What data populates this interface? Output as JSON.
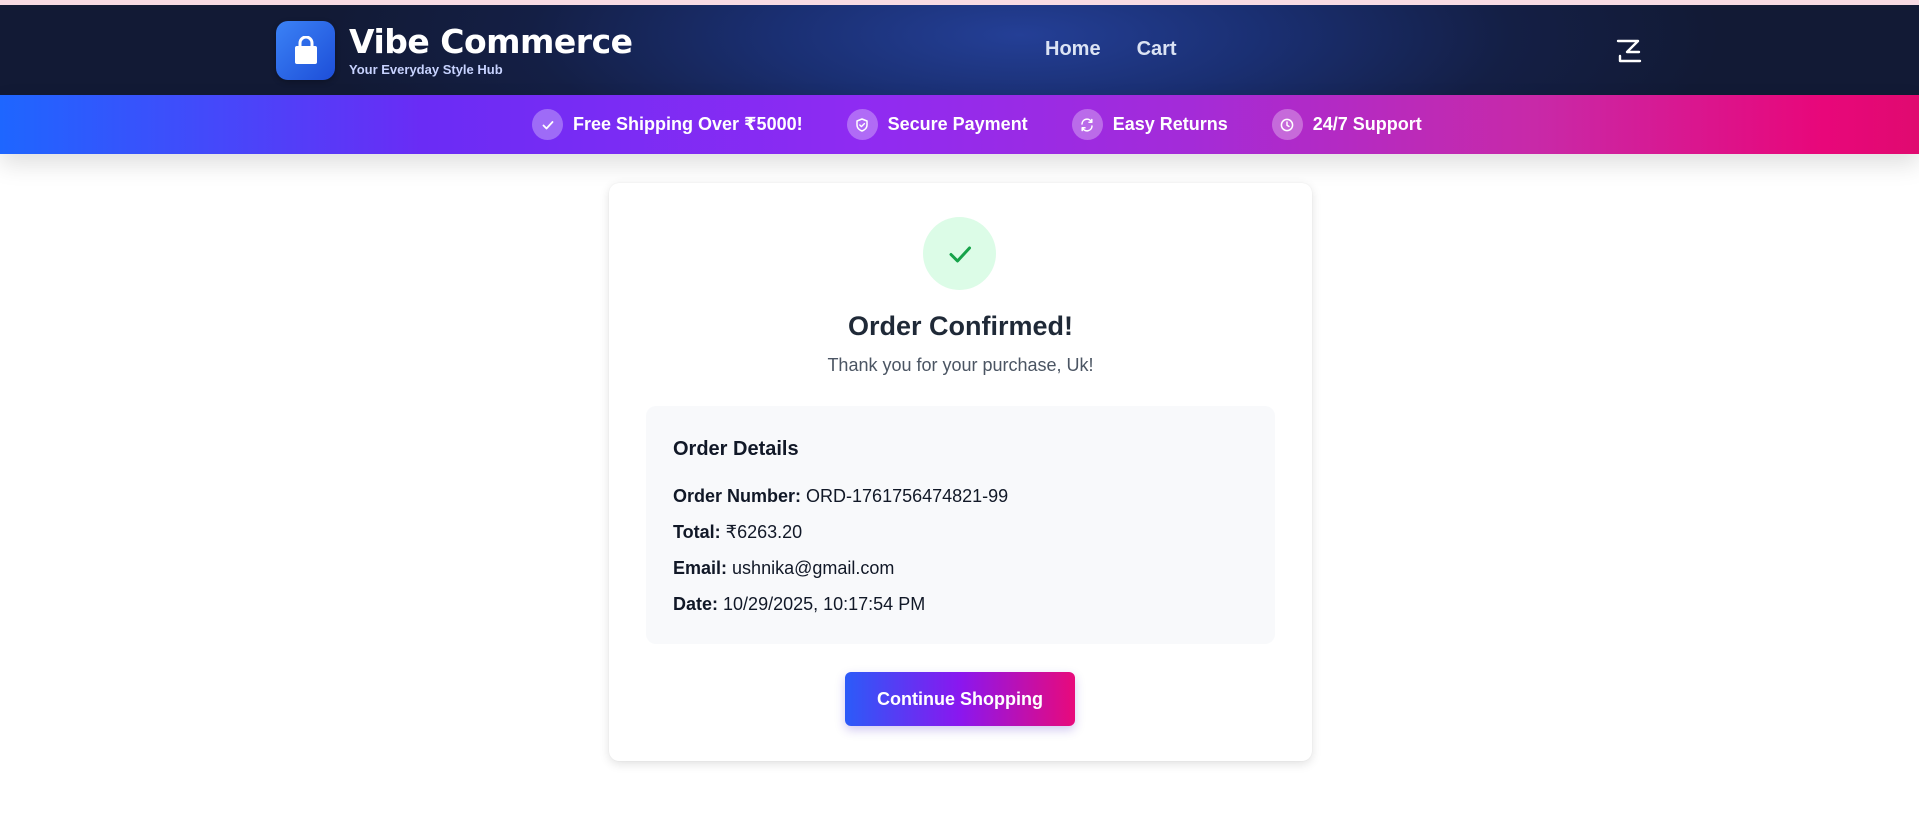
{
  "header": {
    "brand_title": "Vibe Commerce",
    "brand_tagline": "Your Everyday Style Hub",
    "nav": [
      {
        "label": "Home"
      },
      {
        "label": "Cart"
      }
    ],
    "icons": {
      "logo": "shopping-bag-icon",
      "cart": "cart-icon"
    }
  },
  "promo_bar": {
    "items": [
      {
        "icon": "check-icon",
        "label": "Free Shipping Over ₹5000!"
      },
      {
        "icon": "shield-icon",
        "label": "Secure Payment"
      },
      {
        "icon": "refresh-icon",
        "label": "Easy Returns"
      },
      {
        "icon": "clock-icon",
        "label": "24/7 Support"
      }
    ]
  },
  "confirmation": {
    "icon": "check-icon",
    "title": "Order Confirmed!",
    "subtitle": "Thank you for your purchase, Uk!",
    "details": {
      "heading": "Order Details",
      "order_number_label": "Order Number:",
      "order_number": "ORD-1761756474821-99",
      "total_label": "Total:",
      "total": "₹6263.20",
      "email_label": "Email:",
      "email": "ushnika@gmail.com",
      "date_label": "Date:",
      "date": "10/29/2025, 10:17:54 PM"
    },
    "continue_label": "Continue Shopping"
  },
  "colors": {
    "header_bg": "#141f45",
    "promo_start": "#1e66ff",
    "promo_mid": "#8f2bf2",
    "promo_end": "#e00a70",
    "success_bg": "#dcfce7",
    "success_check": "#16a34a"
  }
}
